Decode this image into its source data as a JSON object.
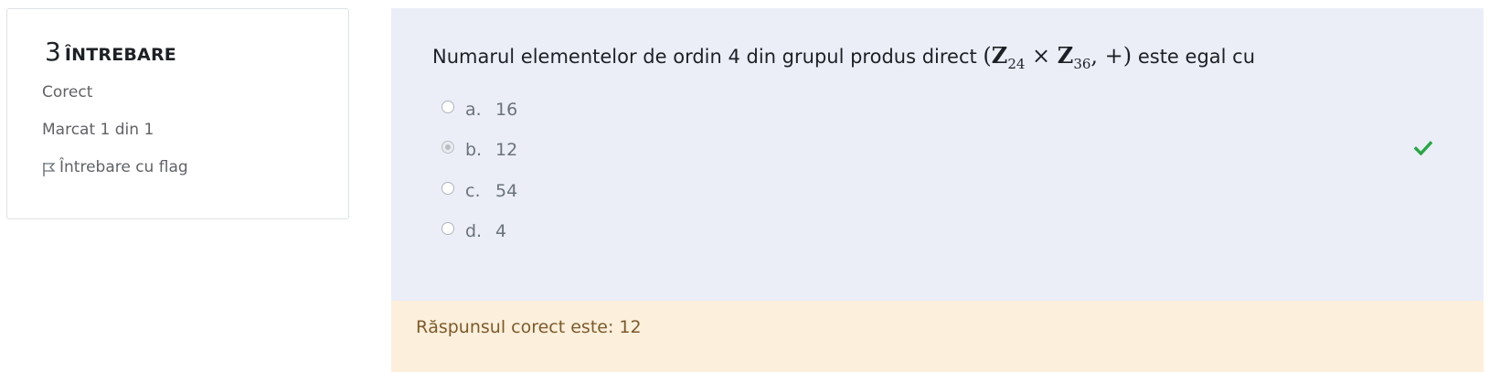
{
  "info": {
    "number": "3",
    "label": "ÎNTREBARE",
    "status": "Corect",
    "grade": "Marcat 1 din 1",
    "flag_label": "Întrebare cu flag"
  },
  "question": {
    "text_before": "Numarul elementelor de ordin 4 din grupul produs direct ",
    "math": {
      "open": "(",
      "z1": "Z",
      "sub1": "24",
      "times": " × ",
      "z2": "Z",
      "sub2": "36",
      "rest": ", +)"
    },
    "text_after": " este egal cu",
    "options": [
      {
        "letter": "a.",
        "value": "16",
        "selected": false
      },
      {
        "letter": "b.",
        "value": "12",
        "selected": true
      },
      {
        "letter": "c.",
        "value": "54",
        "selected": false
      },
      {
        "letter": "d.",
        "value": "4",
        "selected": false
      }
    ],
    "result_icon": "check-icon",
    "result_color": "#28a745"
  },
  "feedback": {
    "text": "Răspunsul corect este: 12"
  }
}
